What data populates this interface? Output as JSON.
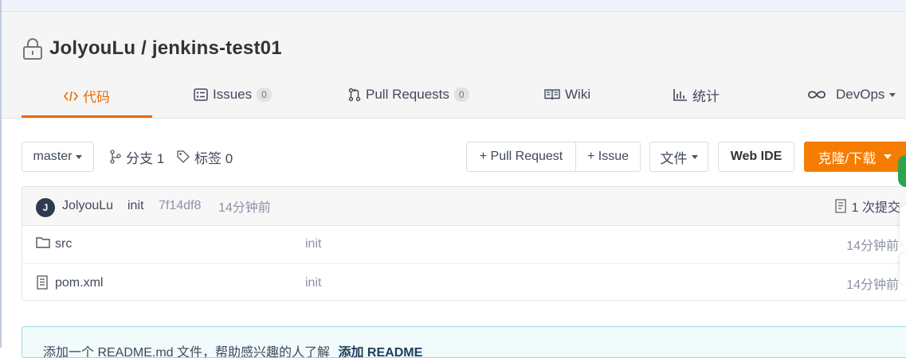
{
  "repo": {
    "owner": "JolyouLu",
    "separator": "/",
    "name": "jenkins-test01"
  },
  "tabs": [
    {
      "label": "代码",
      "icon": "code-icon"
    },
    {
      "label": "Issues",
      "badge": "0",
      "icon": "issues-icon"
    },
    {
      "label": "Pull Requests",
      "badge": "0",
      "icon": "pull-request-icon"
    },
    {
      "label": "Wiki",
      "icon": "book-icon"
    },
    {
      "label": "统计",
      "icon": "bar-chart-icon"
    },
    {
      "label": "DevOps",
      "icon": "infinity-icon"
    }
  ],
  "toolbar": {
    "branch": "master",
    "branches_label": "分支 1",
    "tags_label": "标签 0",
    "pull_request": "+ Pull Request",
    "issue": "+ Issue",
    "file": "文件",
    "web_ide": "Web IDE",
    "clone": "克隆/下载"
  },
  "commit": {
    "avatar_initial": "J",
    "author": "JolyouLu",
    "message": "init",
    "sha": "7f14df8",
    "time": "14分钟前",
    "count": "1 次提交"
  },
  "files": [
    {
      "name": "src",
      "type": "folder",
      "message": "init",
      "time": "14分钟前"
    },
    {
      "name": "pom.xml",
      "type": "file",
      "message": "init",
      "time": "14分钟前"
    }
  ],
  "readme": {
    "text": "添加一个 README.md 文件，帮助感兴趣的人了解",
    "link": "添加 README"
  },
  "colors": {
    "accent": "#e96900",
    "clone": "#f57c00",
    "readme_border": "#9fd8dd"
  }
}
